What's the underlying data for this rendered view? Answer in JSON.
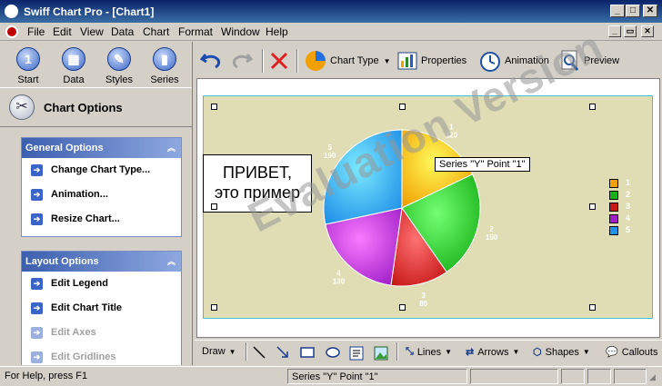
{
  "window": {
    "title": "Swiff Chart Pro - [Chart1]"
  },
  "menu": [
    "File",
    "Edit",
    "View",
    "Data",
    "Chart",
    "Format",
    "Window",
    "Help"
  ],
  "nav": [
    {
      "label": "Start",
      "glyph": "1"
    },
    {
      "label": "Data",
      "glyph": "▦"
    },
    {
      "label": "Styles",
      "glyph": "✎"
    },
    {
      "label": "Series",
      "glyph": "▮"
    }
  ],
  "panel": {
    "title": "Chart Options"
  },
  "groups": {
    "general": {
      "title": "General Options",
      "items": [
        "Change Chart Type...",
        "Animation...",
        "Resize Chart..."
      ]
    },
    "layout": {
      "title": "Layout Options",
      "items": [
        "Edit Legend",
        "Edit Chart Title",
        "Edit Axes",
        "Edit Gridlines"
      ]
    }
  },
  "toolbar": {
    "chart_type": "Chart Type",
    "properties": "Properties",
    "animation": "Animation",
    "preview": "Preview"
  },
  "chart": {
    "callout_line1": "ПРИВЕТ,",
    "callout_line2": "это пример",
    "tooltip": "Series \"Y\" Point \"1\"",
    "watermark": "Evaluation Version"
  },
  "chart_data": {
    "type": "pie",
    "categories": [
      "1",
      "2",
      "3",
      "4",
      "5"
    ],
    "values": [
      120,
      150,
      80,
      130,
      190
    ],
    "labels": [
      "1\n120",
      "2\n150",
      "3\n80",
      "4\n130",
      "5\n190"
    ],
    "colors": [
      "#f0a000",
      "#18b018",
      "#c81818",
      "#a020c8",
      "#2090e8"
    ],
    "legend": "right"
  },
  "drawbar": {
    "draw": "Draw",
    "lines": "Lines",
    "arrows": "Arrows",
    "shapes": "Shapes",
    "callouts": "Callouts"
  },
  "status": {
    "help": "For Help, press F1",
    "info": "Series \"Y\" Point \"1\""
  },
  "colors": {
    "titlebar": "#0a246a",
    "group_header": "#3c5fae",
    "chart_bg": "#e0ddb5"
  }
}
